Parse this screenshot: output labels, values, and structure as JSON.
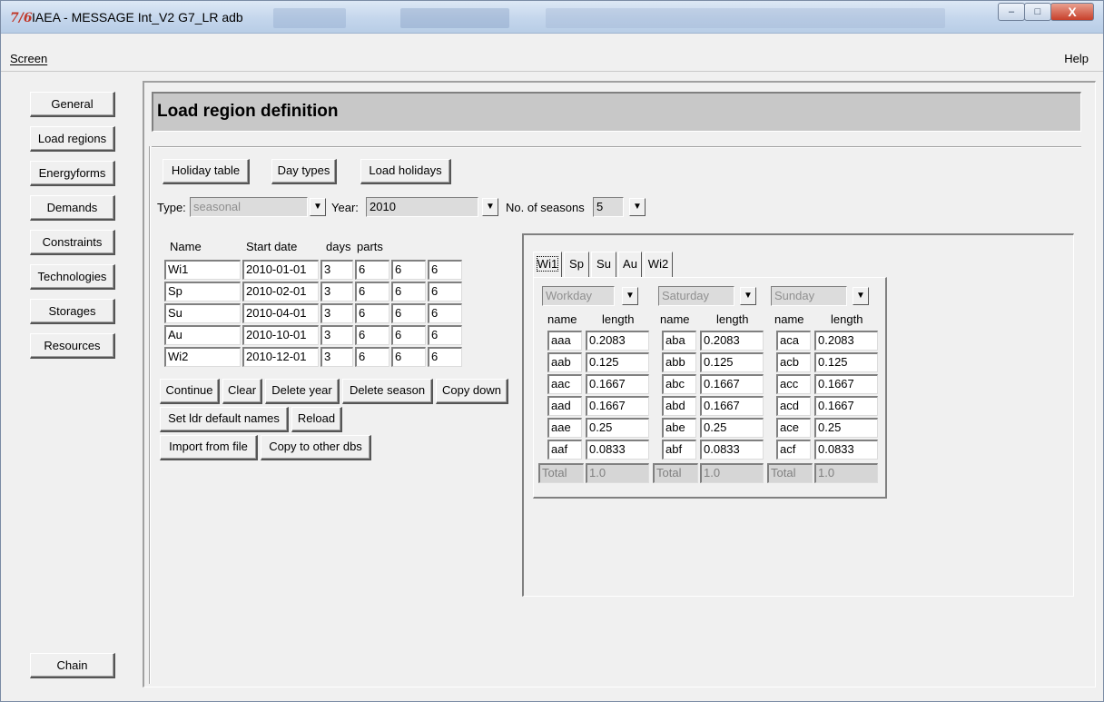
{
  "window": {
    "title": "IAEA - MESSAGE Int_V2 G7_LR adb",
    "icon_label": "7/6",
    "minimize_glyph": "–",
    "maximize_glyph": "□",
    "close_glyph": "X"
  },
  "menu": {
    "screen": "Screen",
    "help": "Help"
  },
  "sidebar": {
    "items": [
      "General",
      "Load regions",
      "Energyforms",
      "Demands",
      "Constraints",
      "Technologies",
      "Storages",
      "Resources"
    ],
    "chain": "Chain"
  },
  "page_title": "Load region definition",
  "toolbar": {
    "holiday_table": "Holiday table",
    "day_types": "Day types",
    "load_holidays": "Load holidays"
  },
  "selectors": {
    "type_label": "Type:",
    "type_value": "seasonal",
    "year_label": "Year:",
    "year_value": "2010",
    "seasons_label": "No. of seasons",
    "seasons_value": "5",
    "arrow": "▼"
  },
  "season_table": {
    "headers": [
      "Name",
      "Start date",
      "days",
      "parts"
    ],
    "rows": [
      [
        "Wi1",
        "2010-01-01",
        "3",
        "6",
        "6",
        "6"
      ],
      [
        "Sp",
        "2010-02-01",
        "3",
        "6",
        "6",
        "6"
      ],
      [
        "Su",
        "2010-04-01",
        "3",
        "6",
        "6",
        "6"
      ],
      [
        "Au",
        "2010-10-01",
        "3",
        "6",
        "6",
        "6"
      ],
      [
        "Wi2",
        "2010-12-01",
        "3",
        "6",
        "6",
        "6"
      ]
    ]
  },
  "actions": {
    "continue": "Continue",
    "clear": "Clear",
    "delete_year": "Delete year",
    "delete_season": "Delete season",
    "copy_down": "Copy down",
    "set_default_names": "Set ldr default names",
    "reload": "Reload",
    "import_from_file": "Import from file",
    "copy_to_other_dbs": "Copy to other dbs"
  },
  "season_tabs": [
    "Wi1",
    "Sp",
    "Su",
    "Au",
    "Wi2"
  ],
  "day_types": [
    {
      "label": "Workday",
      "name_hdr": "name",
      "length_hdr": "length",
      "rows": [
        [
          "aaa",
          "0.2083"
        ],
        [
          "aab",
          "0.125"
        ],
        [
          "aac",
          "0.1667"
        ],
        [
          "aad",
          "0.1667"
        ],
        [
          "aae",
          "0.25"
        ],
        [
          "aaf",
          "0.0833"
        ]
      ],
      "total_label": "Total",
      "total_value": "1.0"
    },
    {
      "label": "Saturday",
      "name_hdr": "name",
      "length_hdr": "length",
      "rows": [
        [
          "aba",
          "0.2083"
        ],
        [
          "abb",
          "0.125"
        ],
        [
          "abc",
          "0.1667"
        ],
        [
          "abd",
          "0.1667"
        ],
        [
          "abe",
          "0.25"
        ],
        [
          "abf",
          "0.0833"
        ]
      ],
      "total_label": "Total",
      "total_value": "1.0"
    },
    {
      "label": "Sunday",
      "name_hdr": "name",
      "length_hdr": "length",
      "rows": [
        [
          "aca",
          "0.2083"
        ],
        [
          "acb",
          "0.125"
        ],
        [
          "acc",
          "0.1667"
        ],
        [
          "acd",
          "0.1667"
        ],
        [
          "ace",
          "0.25"
        ],
        [
          "acf",
          "0.0833"
        ]
      ],
      "total_label": "Total",
      "total_value": "1.0"
    }
  ]
}
